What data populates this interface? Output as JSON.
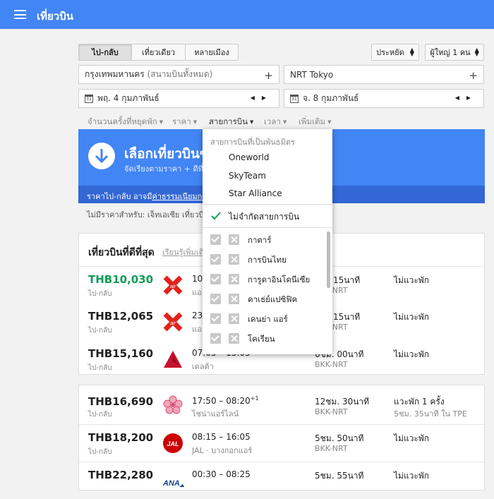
{
  "app": {
    "title": "เที่ยวบิน"
  },
  "trip_tabs": [
    "ไป-กลับ",
    "เที่ยวเดียว",
    "หลายเมือง"
  ],
  "cabin": "ประหยัด",
  "passengers": "ผู้ใหญ่ 1 คน",
  "origin": "กรุงเทพมหานคร",
  "origin_hint": "(สนามบินทั้งหมด)",
  "destination": "NRT Tokyo",
  "depart_date": "พฤ. 4 กุมภาพันธ์",
  "return_date": "จ. 8 กุมภาพันธ์",
  "calendar_icon_num": "31",
  "filters": [
    "จำนวนครั้งที่หยุดพัก",
    "ราคา",
    "สายการบิน",
    "เวลา",
    "เพิ่มเติม"
  ],
  "banner": {
    "title": "เลือกเที่ยวบินข",
    "subtitle": "จัดเรียงตามราคา + ดีที่"
  },
  "price_note": {
    "prefix": "ราคาไป-กลับ อาจมี",
    "link": "ค่าธรรมเนียมกร"
  },
  "no_price_note": "ไม่มีราคาสำหรับ: เจ็ทเอเชีย เที่ยวบิ",
  "best": {
    "title": "เที่ยวบินที่ดีที่สุด",
    "learn_more": "เรียนรู้เพิ่มเติ"
  },
  "flights_best": [
    {
      "price": "THB10,030",
      "trip": "ไป-กลับ",
      "time": "10:",
      "airline": "แอ",
      "duration": "15นาที",
      "route": "BKK-NRT",
      "stops": "ไม่แวะพัก",
      "layover": "",
      "logo": "airasia-logo"
    },
    {
      "price": "THB12,065",
      "trip": "ไป-กลับ",
      "time": "23:",
      "airline": "แอ",
      "duration": "15นาที",
      "route": "BKK-NRT",
      "stops": "ไม่แวะพัก",
      "layover": "",
      "logo": "airasia-logo"
    },
    {
      "price": "THB15,160",
      "trip": "ไป-กลับ",
      "time": "07:05 – 15:05",
      "airline": "เดลต้า",
      "duration": "6ชม. 00นาที",
      "route": "BKK-NRT",
      "stops": "ไม่แวะพัก",
      "layover": "",
      "logo": "delta-logo"
    }
  ],
  "flights_other": [
    {
      "price": "THB16,690",
      "trip": "ไป-กลับ",
      "time": "17:50 – 08:20",
      "time_sup": "+1",
      "airline": "ไชน่าแอร์ไลน์",
      "duration": "12ชม. 30นาที",
      "route": "BKK-NRT",
      "stops": "แวะพัก 1 ครั้ง",
      "layover": "5ชม. 35นาที ใน TPE",
      "logo": "china-airlines-logo"
    },
    {
      "price": "THB18,200",
      "trip": "ไป-กลับ",
      "time": "08:15 – 16:05",
      "time_sup": "",
      "airline": "JAL · บางกอกแอร์",
      "duration": "5ชม. 50นาที",
      "route": "BKK-NRT",
      "stops": "ไม่แวะพัก",
      "layover": "",
      "logo": "jal-logo"
    },
    {
      "price": "THB22,280",
      "trip": "ไป-กลับ",
      "time": "00:30 – 08:25",
      "time_sup": "",
      "airline": "",
      "duration": "5ชม. 55นาที",
      "route": "",
      "stops": "ไม่แวะพัก",
      "layover": "",
      "logo": "ana-logo"
    }
  ],
  "logo_text": {
    "jal": "JAL",
    "ana": "ANA"
  },
  "airline_dropdown": {
    "header": "สายการบินที่เป็นพันธมิตร",
    "alliances": [
      "Oneworld",
      "SkyTeam",
      "Star Alliance"
    ],
    "no_limit": "ไม่จำกัดสายการบิน",
    "airlines": [
      "กาตาร์",
      "การบินไทย",
      "การูดาอินโดนีเซีย",
      "คาเธ่ย์แปซิฟิค",
      "เคนย่า แอร์",
      "โคเรียน"
    ]
  },
  "colors": {
    "brand": "#4285f4",
    "price_green": "#0f9d58",
    "check_green": "#0f9d58"
  }
}
